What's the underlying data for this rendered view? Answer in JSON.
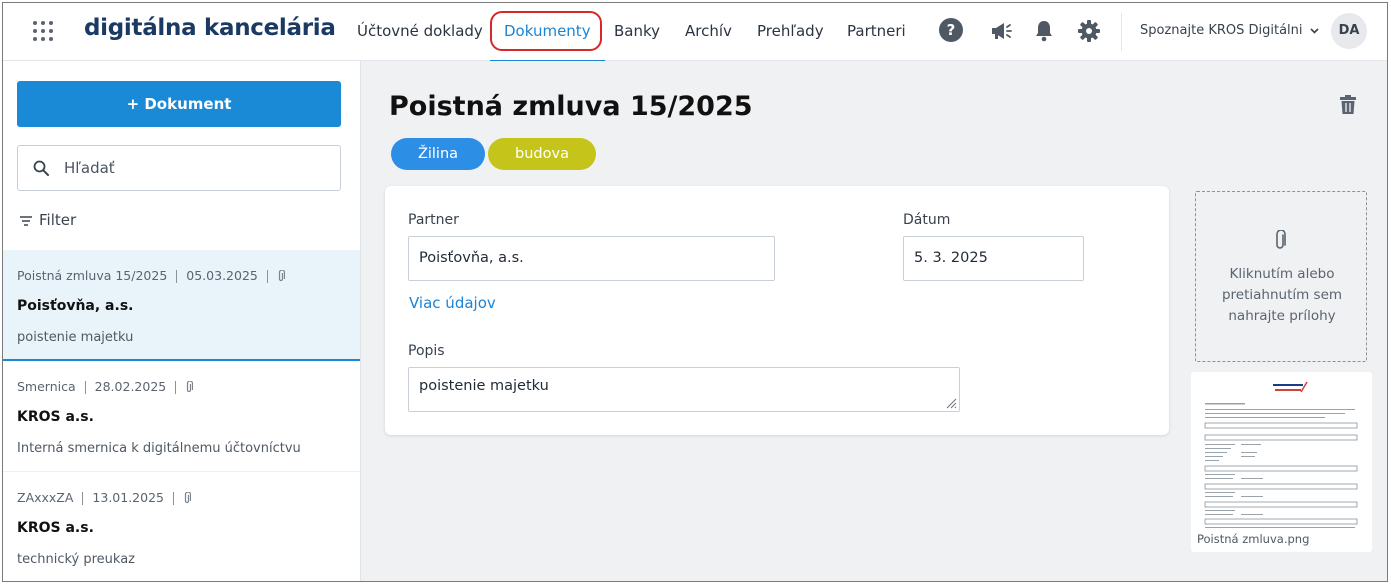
{
  "app": {
    "title": "digitálna kancelária"
  },
  "nav": {
    "items": [
      {
        "label": "Účtovné doklady"
      },
      {
        "label": "Dokumenty"
      },
      {
        "label": "Banky"
      },
      {
        "label": "Archív"
      },
      {
        "label": "Prehľady"
      },
      {
        "label": "Partneri"
      }
    ],
    "active": "Dokumenty",
    "help_label": "?"
  },
  "account": {
    "menu_label": "Spoznajte KROS Digitálni",
    "avatar_initials": "DA"
  },
  "sidebar": {
    "add_button_label": "+ Dokument",
    "search_placeholder": "Hľadať",
    "filter_label": "Filter",
    "documents": [
      {
        "type": "Poistná zmluva 15/2025",
        "date": "05.03.2025",
        "partner": "Poisťovňa, a.s.",
        "description": "poistenie majetku",
        "selected": true
      },
      {
        "type": "Smernica",
        "date": "28.02.2025",
        "partner": "KROS a.s.",
        "description": "Interná smernica k digitálnemu účtovníctvu",
        "selected": false
      },
      {
        "type": "ZAxxxZA",
        "date": "13.01.2025",
        "partner": "KROS a.s.",
        "description": "technický preukaz",
        "selected": false
      }
    ]
  },
  "detail": {
    "title": "Poistná zmluva 15/2025",
    "tags": [
      {
        "label": "Žilina",
        "color": "#2d8ee6"
      },
      {
        "label": "budova",
        "color": "#c4c41a"
      }
    ],
    "partner_label": "Partner",
    "partner_value": "Poisťovňa, a.s.",
    "date_label": "Dátum",
    "date_value": "5. 3. 2025",
    "more_link": "Viac údajov",
    "description_label": "Popis",
    "description_value": "poistenie majetku"
  },
  "attachments": {
    "dropzone_text": "Kliknutím alebo pretiahnutím sem nahrajte prílohy",
    "files": [
      {
        "name": "Poistná zmluva.png"
      }
    ]
  },
  "colors": {
    "accent": "#1a84d6",
    "highlight_ring": "#d62828",
    "brand_text": "#1b3a63"
  }
}
